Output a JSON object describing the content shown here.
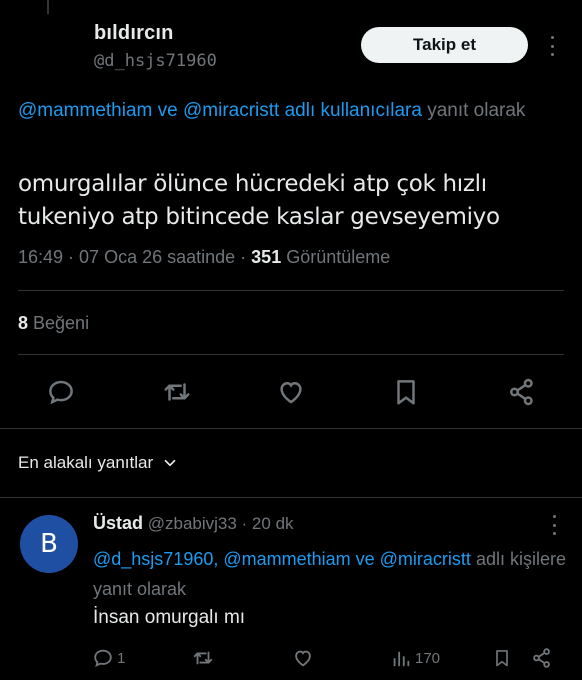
{
  "tweet": {
    "display_name": "bıldırcın",
    "handle": "@d_hsjs71960",
    "follow_label": "Takip et",
    "reply_context": {
      "mention_1": "@mammethiam",
      "joiner": " ve ",
      "mention_2": "@miracristt adlı kullanıcılara",
      "suffix": " yanıt olarak"
    },
    "text": "omurgalılar ölünce hücredeki atp çok hızlı tukeniyo atp bitincede kaslar gevseyemiyo",
    "time": "16:49",
    "sep1": " · ",
    "date": "07 Oca 26 saatinde",
    "sep2": " · ",
    "views_count": "351",
    "views_label": " Görüntüleme",
    "likes_count": "8",
    "likes_label": " Beğeni"
  },
  "replies_section": {
    "header": "En alakalı yanıtlar"
  },
  "reply": {
    "avatar_letter": "B",
    "display_name": "Üstad",
    "handle_time": " @zbabivj33 · 20 dk",
    "context_mentions": "@d_hsjs71960, @mammethiam ve @miracristt",
    "context_suffix": " adlı kişilere yanıt olarak",
    "text": "İnsan omurgalı mı",
    "reply_count": "1",
    "views_count": "170"
  },
  "colors": {
    "background": "#000000",
    "text": "#e7e9ea",
    "muted": "#71767b",
    "accent": "#1d9bf0",
    "divider": "#2f3336",
    "avatar": "#1f4fa3"
  }
}
